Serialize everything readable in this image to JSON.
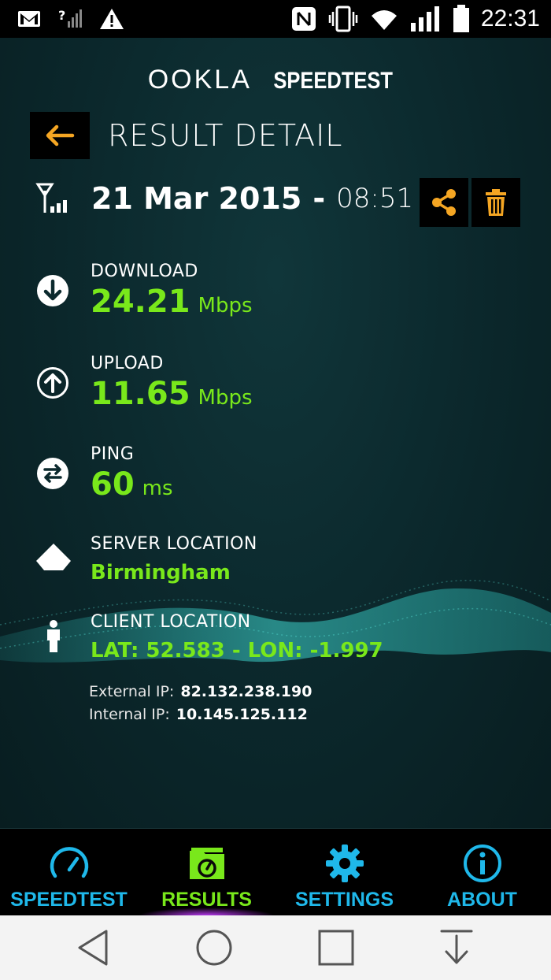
{
  "status_bar": {
    "time": "22:31",
    "icons": [
      "gmail-icon",
      "no-signal-icon",
      "warning-icon",
      "nfc-icon",
      "vibrate-icon",
      "wifi-icon",
      "signal-icon",
      "battery-icon"
    ]
  },
  "header": {
    "brand_ookla": "OOKLA",
    "brand_speedtest": "SPEEDTEST",
    "title": "RESULT DETAIL"
  },
  "result": {
    "date": "21 Mar 2015",
    "separator": "-",
    "time": "08:51",
    "download": {
      "label": "DOWNLOAD",
      "value": "24.21",
      "unit": "Mbps"
    },
    "upload": {
      "label": "UPLOAD",
      "value": "11.65",
      "unit": "Mbps"
    },
    "ping": {
      "label": "PING",
      "value": "60",
      "unit": "ms"
    },
    "server_location": {
      "label": "SERVER LOCATION",
      "value": "Birmingham"
    },
    "client_location": {
      "label": "CLIENT LOCATION",
      "value": "LAT: 52.583 - LON: -1.997"
    },
    "external_ip": {
      "label": "External IP:",
      "value": "82.132.238.190"
    },
    "internal_ip": {
      "label": "Internal IP:",
      "value": "10.145.125.112"
    }
  },
  "bottom_nav": {
    "items": [
      {
        "label": "SPEEDTEST",
        "color": "#1fb8ea",
        "active": false
      },
      {
        "label": "RESULTS",
        "color": "#79e81b",
        "active": true
      },
      {
        "label": "SETTINGS",
        "color": "#1fb8ea",
        "active": false
      },
      {
        "label": "ABOUT",
        "color": "#1fb8ea",
        "active": false
      }
    ]
  },
  "colors": {
    "accent_green": "#79e81b",
    "accent_orange": "#f5a623",
    "accent_blue": "#1fb8ea"
  }
}
